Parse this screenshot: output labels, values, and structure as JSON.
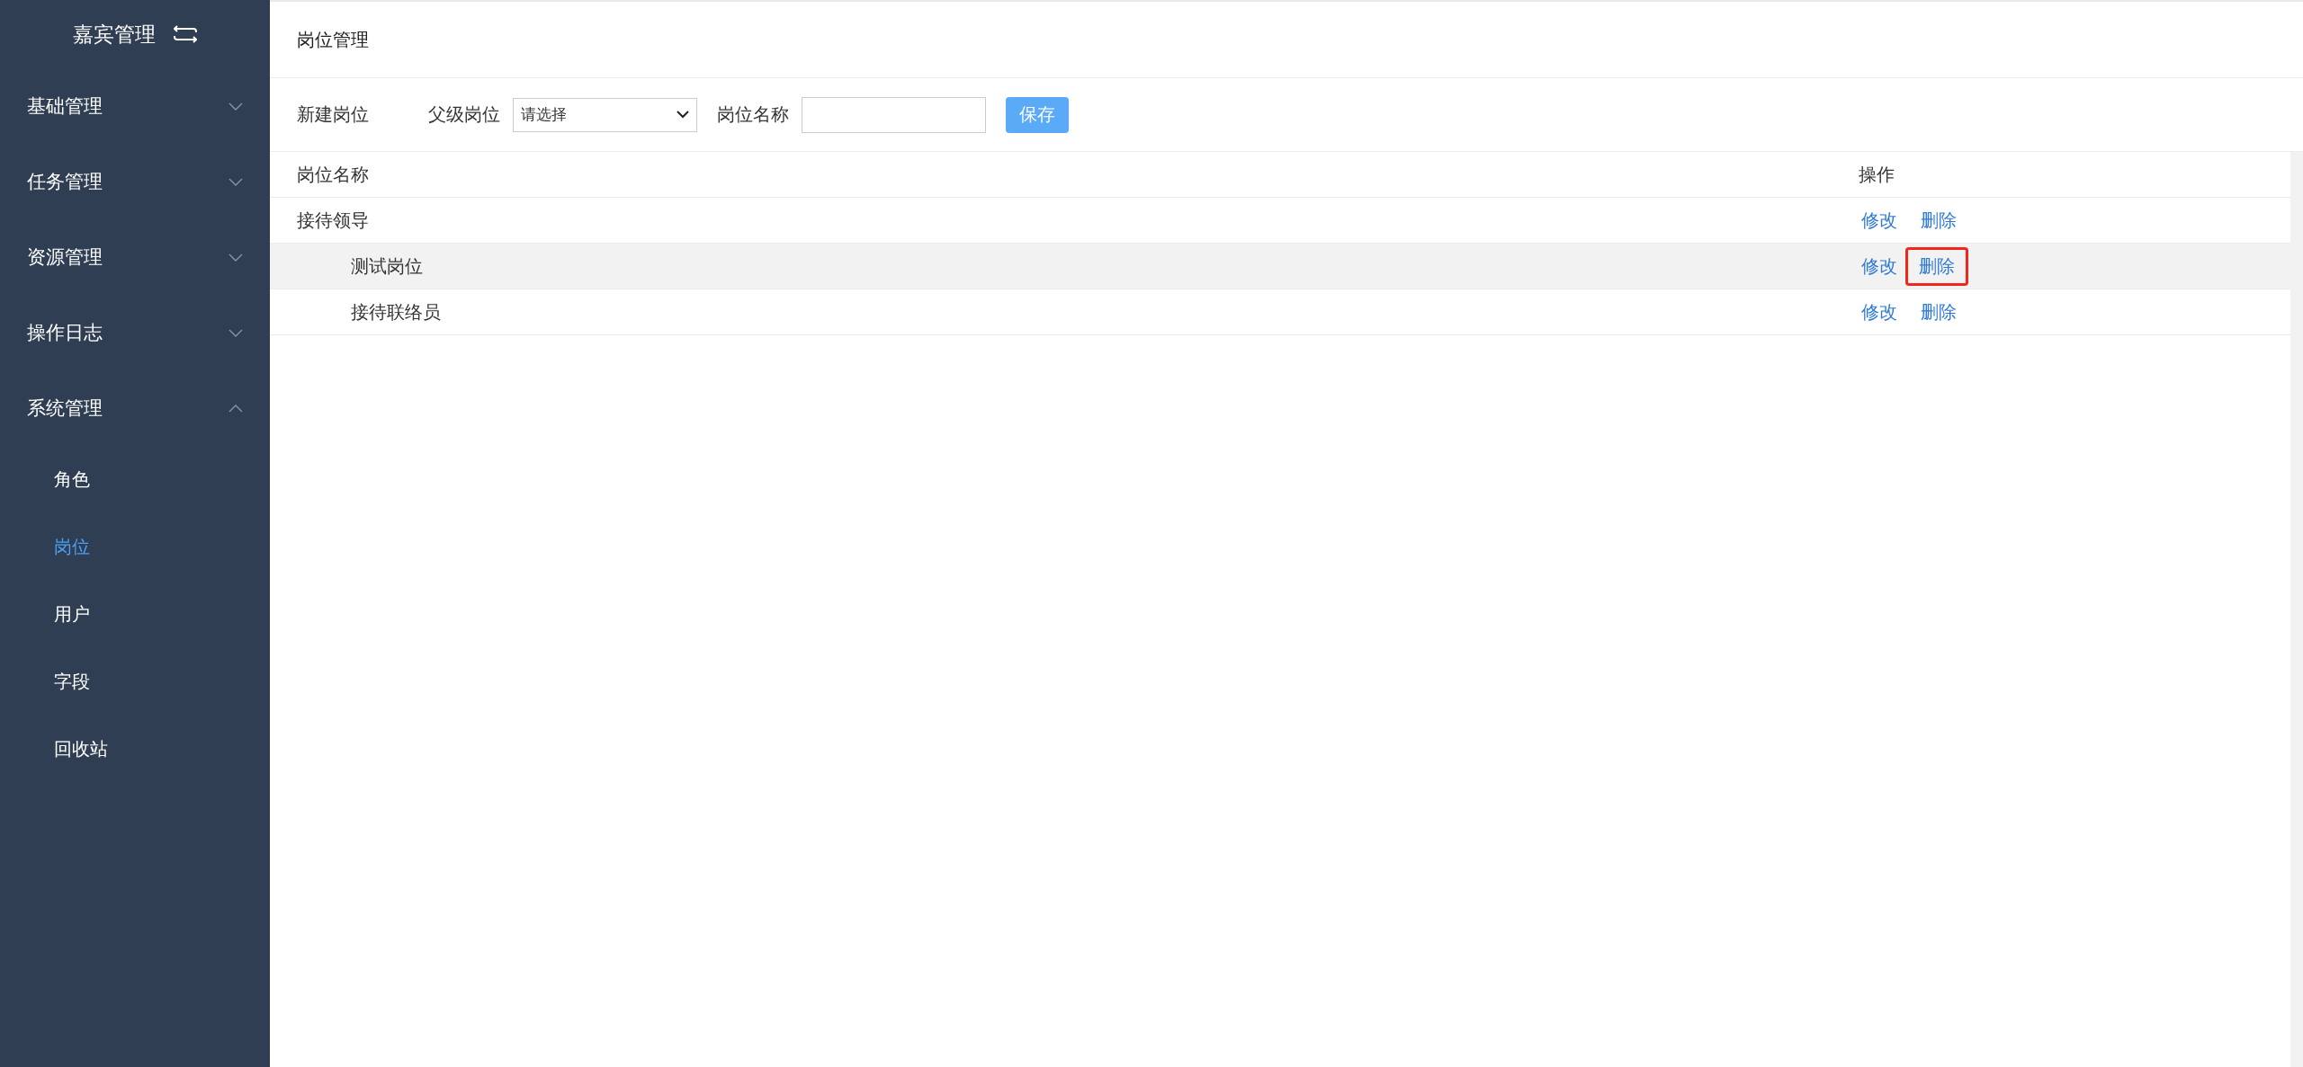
{
  "sidebar": {
    "title": "嘉宾管理",
    "groups": [
      {
        "label": "基础管理",
        "expanded": false
      },
      {
        "label": "任务管理",
        "expanded": false
      },
      {
        "label": "资源管理",
        "expanded": false
      },
      {
        "label": "操作日志",
        "expanded": false
      },
      {
        "label": "系统管理",
        "expanded": true,
        "items": [
          {
            "label": "角色",
            "selected": false
          },
          {
            "label": "岗位",
            "selected": true
          },
          {
            "label": "用户",
            "selected": false
          },
          {
            "label": "字段",
            "selected": false
          },
          {
            "label": "回收站",
            "selected": false
          }
        ]
      }
    ]
  },
  "page_title": "岗位管理",
  "form": {
    "heading": "新建岗位",
    "parent_label": "父级岗位",
    "parent_select": {
      "value": "请选择"
    },
    "name_label": "岗位名称",
    "save_button": "保存"
  },
  "table": {
    "columns": [
      "岗位名称",
      "操作"
    ],
    "rows": [
      {
        "name": "接待领导",
        "hovered": false,
        "actions": [
          {
            "label": "修改",
            "highlighted": false
          },
          {
            "label": "删除",
            "highlighted": false
          }
        ],
        "children": [
          {
            "name": "测试岗位",
            "hovered": true,
            "actions": [
              {
                "label": "修改",
                "highlighted": false
              },
              {
                "label": "删除",
                "highlighted": true
              }
            ]
          },
          {
            "name": "接待联络员",
            "hovered": false,
            "actions": [
              {
                "label": "修改",
                "highlighted": false
              },
              {
                "label": "删除",
                "highlighted": false
              }
            ]
          }
        ]
      }
    ]
  }
}
